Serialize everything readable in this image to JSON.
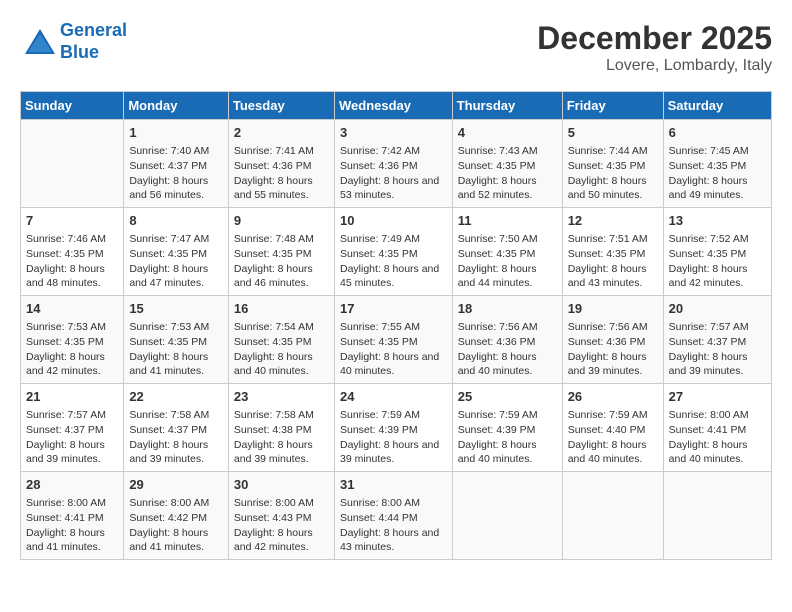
{
  "logo": {
    "line1": "General",
    "line2": "Blue"
  },
  "title": "December 2025",
  "subtitle": "Lovere, Lombardy, Italy",
  "headers": [
    "Sunday",
    "Monday",
    "Tuesday",
    "Wednesday",
    "Thursday",
    "Friday",
    "Saturday"
  ],
  "weeks": [
    [
      {
        "day": "",
        "sunrise": "",
        "sunset": "",
        "daylight": ""
      },
      {
        "day": "1",
        "sunrise": "Sunrise: 7:40 AM",
        "sunset": "Sunset: 4:37 PM",
        "daylight": "Daylight: 8 hours and 56 minutes."
      },
      {
        "day": "2",
        "sunrise": "Sunrise: 7:41 AM",
        "sunset": "Sunset: 4:36 PM",
        "daylight": "Daylight: 8 hours and 55 minutes."
      },
      {
        "day": "3",
        "sunrise": "Sunrise: 7:42 AM",
        "sunset": "Sunset: 4:36 PM",
        "daylight": "Daylight: 8 hours and 53 minutes."
      },
      {
        "day": "4",
        "sunrise": "Sunrise: 7:43 AM",
        "sunset": "Sunset: 4:35 PM",
        "daylight": "Daylight: 8 hours and 52 minutes."
      },
      {
        "day": "5",
        "sunrise": "Sunrise: 7:44 AM",
        "sunset": "Sunset: 4:35 PM",
        "daylight": "Daylight: 8 hours and 50 minutes."
      },
      {
        "day": "6",
        "sunrise": "Sunrise: 7:45 AM",
        "sunset": "Sunset: 4:35 PM",
        "daylight": "Daylight: 8 hours and 49 minutes."
      }
    ],
    [
      {
        "day": "7",
        "sunrise": "Sunrise: 7:46 AM",
        "sunset": "Sunset: 4:35 PM",
        "daylight": "Daylight: 8 hours and 48 minutes."
      },
      {
        "day": "8",
        "sunrise": "Sunrise: 7:47 AM",
        "sunset": "Sunset: 4:35 PM",
        "daylight": "Daylight: 8 hours and 47 minutes."
      },
      {
        "day": "9",
        "sunrise": "Sunrise: 7:48 AM",
        "sunset": "Sunset: 4:35 PM",
        "daylight": "Daylight: 8 hours and 46 minutes."
      },
      {
        "day": "10",
        "sunrise": "Sunrise: 7:49 AM",
        "sunset": "Sunset: 4:35 PM",
        "daylight": "Daylight: 8 hours and 45 minutes."
      },
      {
        "day": "11",
        "sunrise": "Sunrise: 7:50 AM",
        "sunset": "Sunset: 4:35 PM",
        "daylight": "Daylight: 8 hours and 44 minutes."
      },
      {
        "day": "12",
        "sunrise": "Sunrise: 7:51 AM",
        "sunset": "Sunset: 4:35 PM",
        "daylight": "Daylight: 8 hours and 43 minutes."
      },
      {
        "day": "13",
        "sunrise": "Sunrise: 7:52 AM",
        "sunset": "Sunset: 4:35 PM",
        "daylight": "Daylight: 8 hours and 42 minutes."
      }
    ],
    [
      {
        "day": "14",
        "sunrise": "Sunrise: 7:53 AM",
        "sunset": "Sunset: 4:35 PM",
        "daylight": "Daylight: 8 hours and 42 minutes."
      },
      {
        "day": "15",
        "sunrise": "Sunrise: 7:53 AM",
        "sunset": "Sunset: 4:35 PM",
        "daylight": "Daylight: 8 hours and 41 minutes."
      },
      {
        "day": "16",
        "sunrise": "Sunrise: 7:54 AM",
        "sunset": "Sunset: 4:35 PM",
        "daylight": "Daylight: 8 hours and 40 minutes."
      },
      {
        "day": "17",
        "sunrise": "Sunrise: 7:55 AM",
        "sunset": "Sunset: 4:35 PM",
        "daylight": "Daylight: 8 hours and 40 minutes."
      },
      {
        "day": "18",
        "sunrise": "Sunrise: 7:56 AM",
        "sunset": "Sunset: 4:36 PM",
        "daylight": "Daylight: 8 hours and 40 minutes."
      },
      {
        "day": "19",
        "sunrise": "Sunrise: 7:56 AM",
        "sunset": "Sunset: 4:36 PM",
        "daylight": "Daylight: 8 hours and 39 minutes."
      },
      {
        "day": "20",
        "sunrise": "Sunrise: 7:57 AM",
        "sunset": "Sunset: 4:37 PM",
        "daylight": "Daylight: 8 hours and 39 minutes."
      }
    ],
    [
      {
        "day": "21",
        "sunrise": "Sunrise: 7:57 AM",
        "sunset": "Sunset: 4:37 PM",
        "daylight": "Daylight: 8 hours and 39 minutes."
      },
      {
        "day": "22",
        "sunrise": "Sunrise: 7:58 AM",
        "sunset": "Sunset: 4:37 PM",
        "daylight": "Daylight: 8 hours and 39 minutes."
      },
      {
        "day": "23",
        "sunrise": "Sunrise: 7:58 AM",
        "sunset": "Sunset: 4:38 PM",
        "daylight": "Daylight: 8 hours and 39 minutes."
      },
      {
        "day": "24",
        "sunrise": "Sunrise: 7:59 AM",
        "sunset": "Sunset: 4:39 PM",
        "daylight": "Daylight: 8 hours and 39 minutes."
      },
      {
        "day": "25",
        "sunrise": "Sunrise: 7:59 AM",
        "sunset": "Sunset: 4:39 PM",
        "daylight": "Daylight: 8 hours and 40 minutes."
      },
      {
        "day": "26",
        "sunrise": "Sunrise: 7:59 AM",
        "sunset": "Sunset: 4:40 PM",
        "daylight": "Daylight: 8 hours and 40 minutes."
      },
      {
        "day": "27",
        "sunrise": "Sunrise: 8:00 AM",
        "sunset": "Sunset: 4:41 PM",
        "daylight": "Daylight: 8 hours and 40 minutes."
      }
    ],
    [
      {
        "day": "28",
        "sunrise": "Sunrise: 8:00 AM",
        "sunset": "Sunset: 4:41 PM",
        "daylight": "Daylight: 8 hours and 41 minutes."
      },
      {
        "day": "29",
        "sunrise": "Sunrise: 8:00 AM",
        "sunset": "Sunset: 4:42 PM",
        "daylight": "Daylight: 8 hours and 41 minutes."
      },
      {
        "day": "30",
        "sunrise": "Sunrise: 8:00 AM",
        "sunset": "Sunset: 4:43 PM",
        "daylight": "Daylight: 8 hours and 42 minutes."
      },
      {
        "day": "31",
        "sunrise": "Sunrise: 8:00 AM",
        "sunset": "Sunset: 4:44 PM",
        "daylight": "Daylight: 8 hours and 43 minutes."
      },
      {
        "day": "",
        "sunrise": "",
        "sunset": "",
        "daylight": ""
      },
      {
        "day": "",
        "sunrise": "",
        "sunset": "",
        "daylight": ""
      },
      {
        "day": "",
        "sunrise": "",
        "sunset": "",
        "daylight": ""
      }
    ]
  ]
}
